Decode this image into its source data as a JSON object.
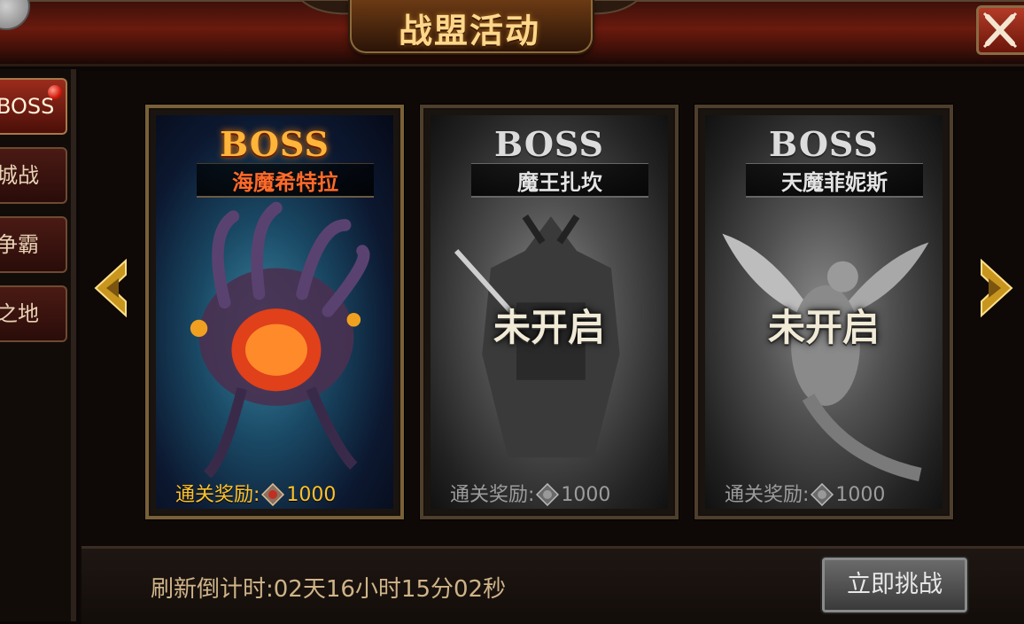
{
  "header": {
    "title": "战盟活动"
  },
  "sidebar": {
    "tabs": [
      {
        "label": "BOSS",
        "active": true,
        "badge": true
      },
      {
        "label": "城战",
        "active": false
      },
      {
        "label": "争霸",
        "active": false
      },
      {
        "label": "之地",
        "active": false
      }
    ]
  },
  "cards": [
    {
      "heading": "BOSS",
      "name": "海魔希特拉",
      "status": "",
      "reward_label": "通关奖励:",
      "reward_value": "1000",
      "unlocked": true
    },
    {
      "heading": "BOSS",
      "name": "魔王扎坎",
      "status": "未开启",
      "reward_label": "通关奖励:",
      "reward_value": "1000",
      "unlocked": false
    },
    {
      "heading": "BOSS",
      "name": "天魔菲妮斯",
      "status": "未开启",
      "reward_label": "通关奖励:",
      "reward_value": "1000",
      "unlocked": false
    }
  ],
  "footer": {
    "countdown": "刷新倒计时:02天16小时15分02秒",
    "challenge_label": "立即挑战"
  },
  "icons": {
    "close": "close-icon",
    "prev": "arrow-left-icon",
    "next": "arrow-right-icon",
    "reward": "guild-emblem-icon"
  },
  "colors": {
    "accent_gold": "#ffb43a",
    "header_red": "#6a1a0e",
    "active_name": "#ff6a2a"
  }
}
